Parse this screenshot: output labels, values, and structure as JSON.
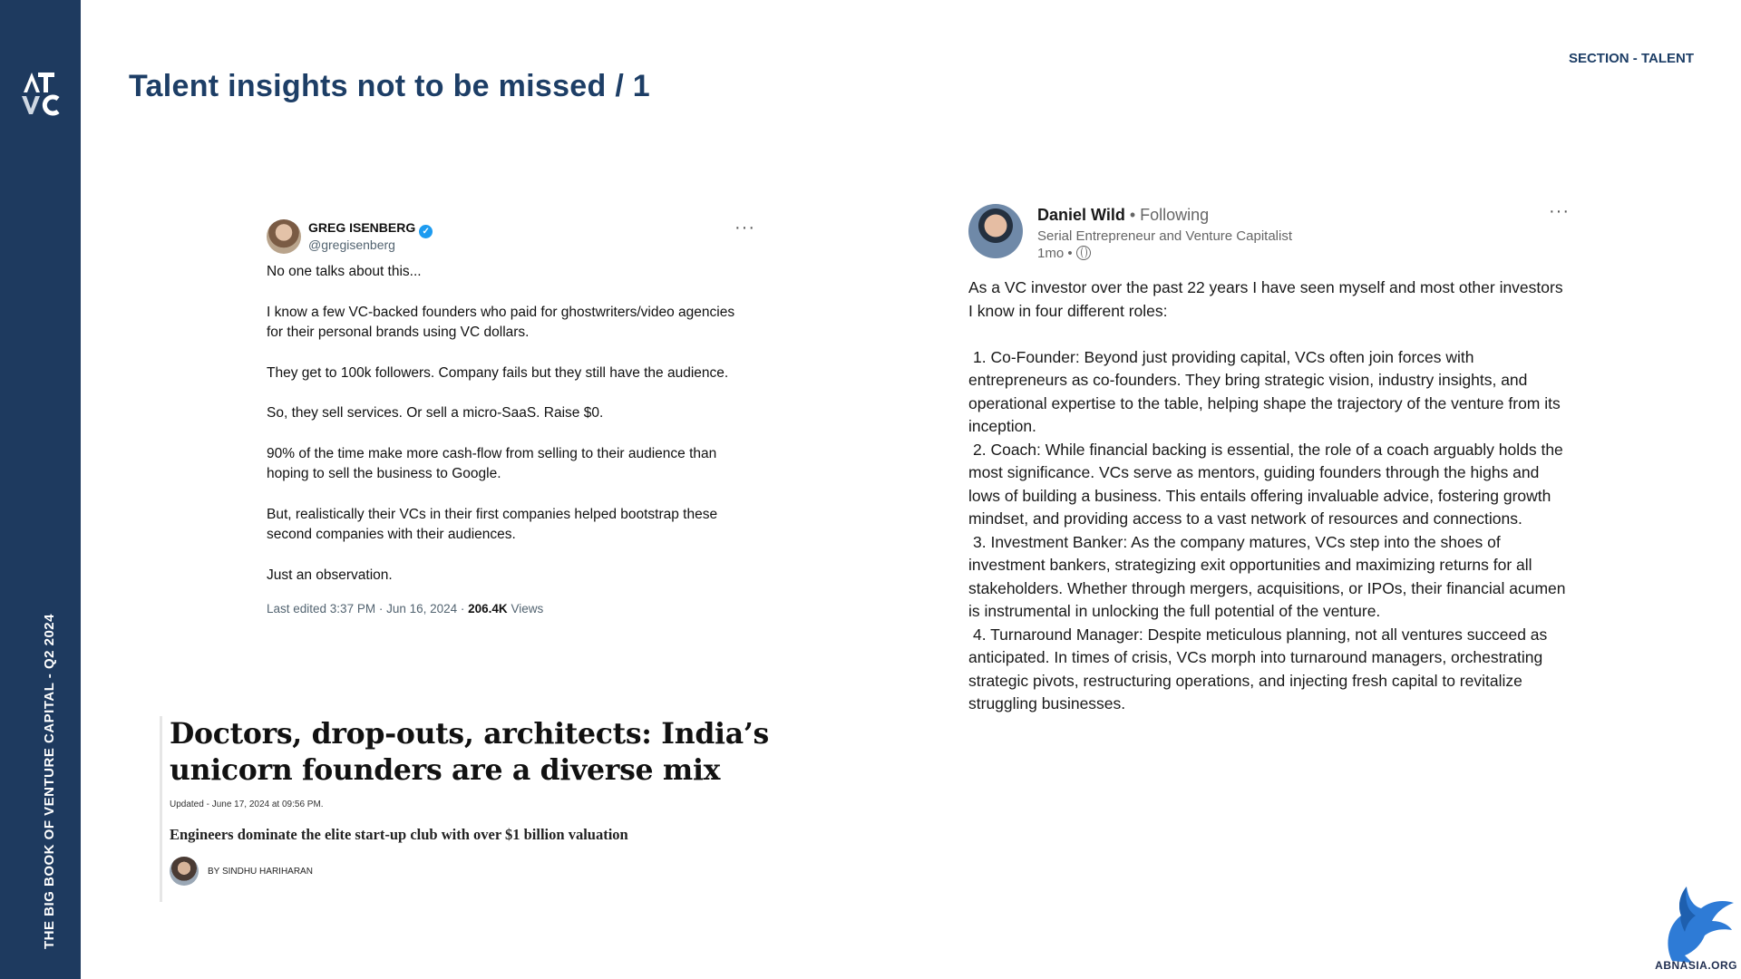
{
  "sidebar": {
    "logo_text": "ATVC",
    "vertical_label": "THE BIG BOOK OF VENTURE CAPITAL - Q2 2024"
  },
  "header": {
    "section": "SECTION - TALENT",
    "title": "Talent insights not to be missed / 1"
  },
  "tweet": {
    "name": "GREG ISENBERG",
    "handle": "@gregisenberg",
    "more_icon": "more-horizontal-icon",
    "paragraphs": [
      "No one talks about this...",
      "I know a few VC-backed founders who paid for ghostwriters/video agencies for their personal brands using VC dollars.",
      "They get to 100k followers. Company fails but they still have the audience.",
      "So, they sell services. Or sell a micro-SaaS. Raise $0.",
      "90% of the time make more cash-flow from selling to their audience than hoping to sell the business to Google.",
      "But, realistically their VCs in their first companies helped bootstrap these second companies with their audiences.",
      "Just an observation."
    ],
    "meta_prefix": "Last edited 3:37 PM · Jun 16, 2024 · ",
    "views_count": "206.4K",
    "views_label": " Views"
  },
  "article": {
    "headline": "Doctors, drop-outs, architects: India’s unicorn founders are a diverse mix",
    "updated": "Updated - June 17, 2024 at 09:56 PM.",
    "subhead": "Engineers dominate the elite start-up club with over $1 billion valuation",
    "byline": "BY SINDHU HARIHARAN"
  },
  "post": {
    "name": "Daniel Wild",
    "following": " • Following",
    "subtitle": "Serial Entrepreneur and Venture Capitalist",
    "time": "1mo •",
    "intro": "As a VC investor over the past 22 years I have seen myself and most other investors I know in four different roles:",
    "items": [
      "1. Co-Founder: Beyond just providing capital, VCs often join forces with entrepreneurs as co-founders. They bring strategic vision, industry insights, and operational expertise to the table, helping shape the trajectory of the venture from its inception.",
      "2. Coach: While financial backing is essential, the role of a coach arguably holds the most significance. VCs serve as mentors, guiding founders through the highs and lows of building a business. This entails offering invaluable advice, fostering growth mindset, and providing access to a vast network of resources and connections.",
      "3. Investment Banker: As the company matures, VCs step into the shoes of investment bankers, strategizing exit opportunities and maximizing returns for all stakeholders. Whether through mergers, acquisitions, or IPOs, their financial acumen is instrumental in unlocking the full potential of the venture.",
      "4. Turnaround Manager: Despite meticulous planning, not all ventures succeed as anticipated. In times of crisis, VCs morph into turnaround managers, orchestrating strategic pivots, restructuring operations, and injecting fresh capital to revitalize struggling businesses."
    ]
  },
  "watermark": {
    "text": "ABNASIA.ORG"
  }
}
